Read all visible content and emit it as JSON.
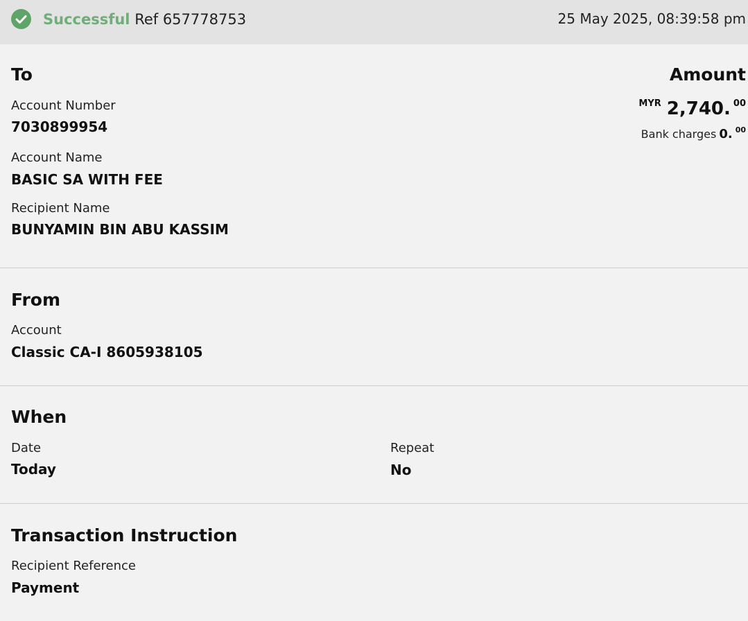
{
  "status": {
    "label": "Successful",
    "ref": "Ref 657778753",
    "timestamp": "25 May 2025, 08:39:58 pm",
    "colors": {
      "success": "#6fae78",
      "check_bg": "#5fa568"
    },
    "icon": "check-circle-icon"
  },
  "to": {
    "title": "To",
    "account_number_label": "Account Number",
    "account_number": "7030899954",
    "account_name_label": "Account Name",
    "account_name": "BASIC SA WITH FEE",
    "recipient_name_label": "Recipient Name",
    "recipient_name": "BUNYAMIN BIN ABU KASSIM"
  },
  "amount": {
    "title": "Amount",
    "currency": "MYR",
    "value_main": "2,740.",
    "value_cents": "00",
    "charges_label": "Bank charges",
    "charges_main": "0.",
    "charges_cents": "00"
  },
  "from": {
    "title": "From",
    "account_label": "Account",
    "account_value": "Classic CA-I 8605938105"
  },
  "when": {
    "title": "When",
    "date_label": "Date",
    "date_value": "Today",
    "repeat_label": "Repeat",
    "repeat_value": "No"
  },
  "instruction": {
    "title": "Transaction Instruction",
    "recipient_reference_label": "Recipient Reference",
    "recipient_reference_value": "Payment"
  }
}
